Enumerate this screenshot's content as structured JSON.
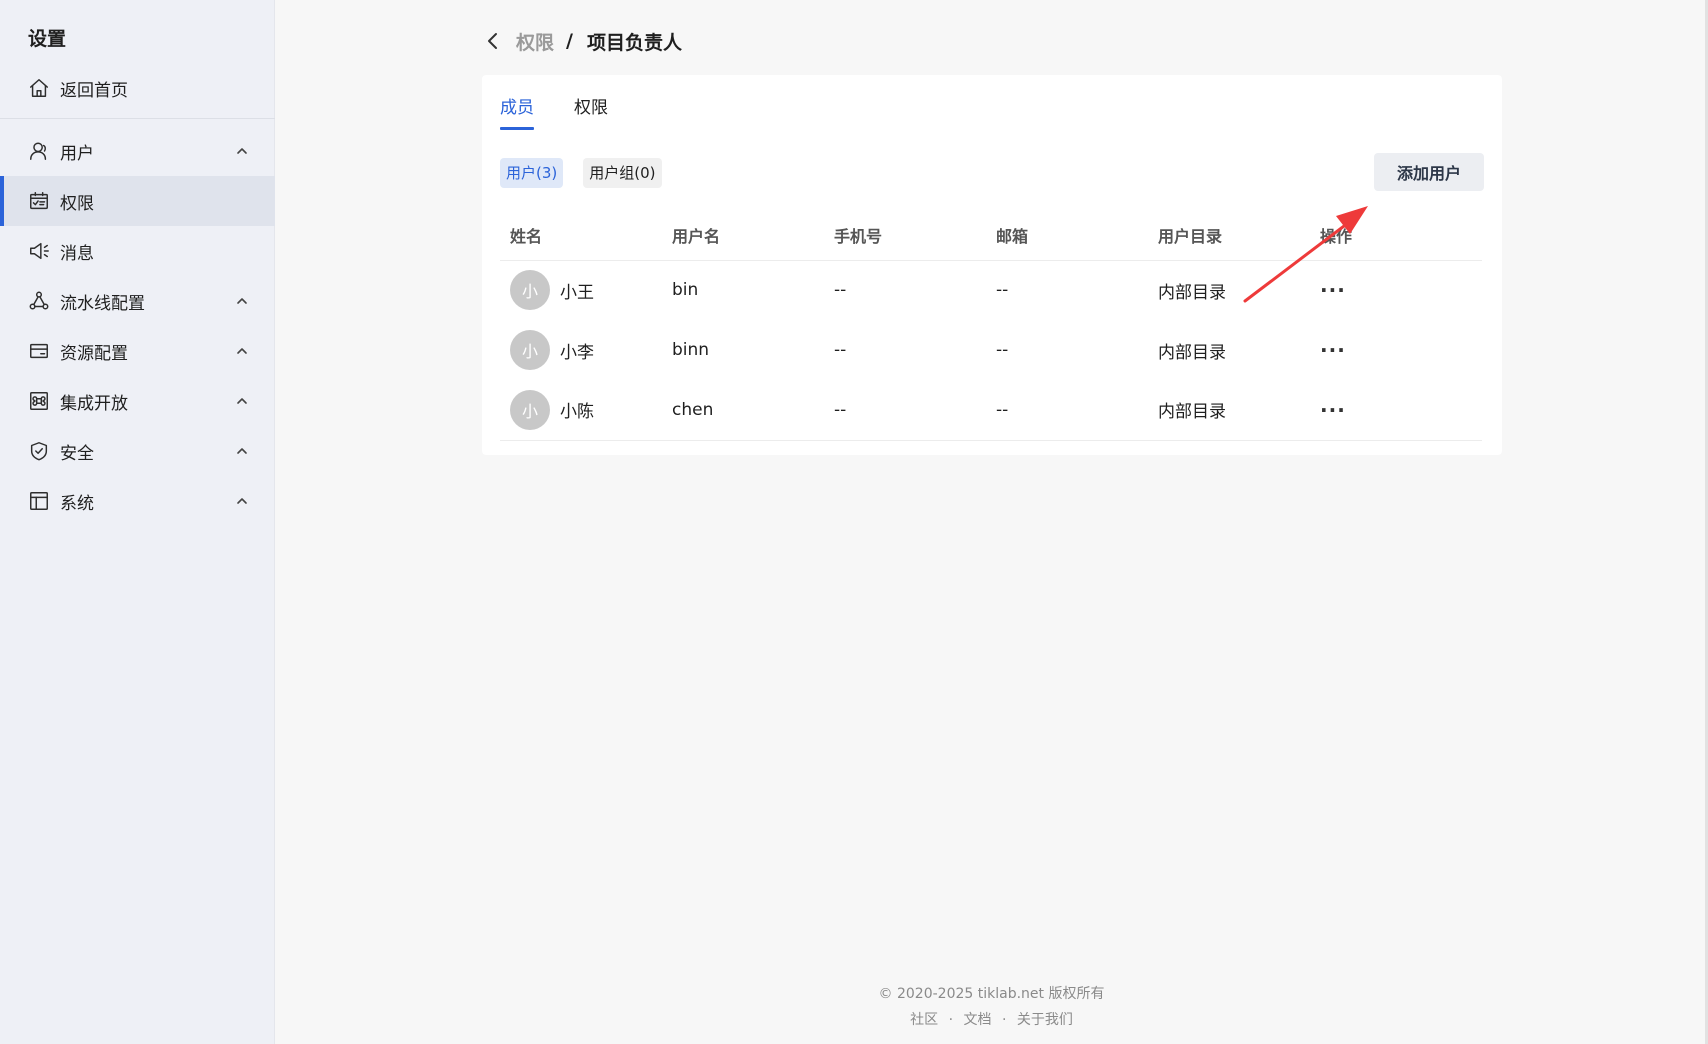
{
  "sidebar": {
    "title": "设置",
    "home_label": "返回首页",
    "items": [
      {
        "label": "用户",
        "icon": "user-icon",
        "expandable": true
      },
      {
        "label": "权限",
        "icon": "permission-icon",
        "active": true
      },
      {
        "label": "消息",
        "icon": "megaphone-icon"
      },
      {
        "label": "流水线配置",
        "icon": "pipeline-icon",
        "expandable": true
      },
      {
        "label": "资源配置",
        "icon": "card-icon",
        "expandable": true
      },
      {
        "label": "集成开放",
        "icon": "command-icon",
        "expandable": true
      },
      {
        "label": "安全",
        "icon": "shield-icon",
        "expandable": true
      },
      {
        "label": "系统",
        "icon": "layout-icon",
        "expandable": true
      }
    ]
  },
  "breadcrumb": {
    "parent": "权限",
    "separator": "/",
    "current": "项目负责人"
  },
  "tabs": [
    {
      "label": "成员",
      "active": true
    },
    {
      "label": "权限",
      "active": false
    }
  ],
  "filters": [
    {
      "label": "用户(3)",
      "active": true
    },
    {
      "label": "用户组(0)",
      "active": false
    }
  ],
  "add_button": "添加用户",
  "table": {
    "columns": [
      "姓名",
      "用户名",
      "手机号",
      "邮箱",
      "用户目录",
      "操作"
    ],
    "rows": [
      {
        "avatar": "小",
        "name": "小王",
        "username": "bin",
        "phone": "--",
        "email": "--",
        "directory": "内部目录",
        "action": "···"
      },
      {
        "avatar": "小",
        "name": "小李",
        "username": "binn",
        "phone": "--",
        "email": "--",
        "directory": "内部目录",
        "action": "···"
      },
      {
        "avatar": "小",
        "name": "小陈",
        "username": "chen",
        "phone": "--",
        "email": "--",
        "directory": "内部目录",
        "action": "···"
      }
    ]
  },
  "footer": {
    "copyright": "© 2020-2025 tiklab.net 版权所有",
    "links": [
      "社区",
      "文档",
      "关于我们"
    ],
    "separator": "·"
  },
  "colors": {
    "accent": "#2b63d9",
    "annotation_arrow": "#ee3a3a"
  }
}
